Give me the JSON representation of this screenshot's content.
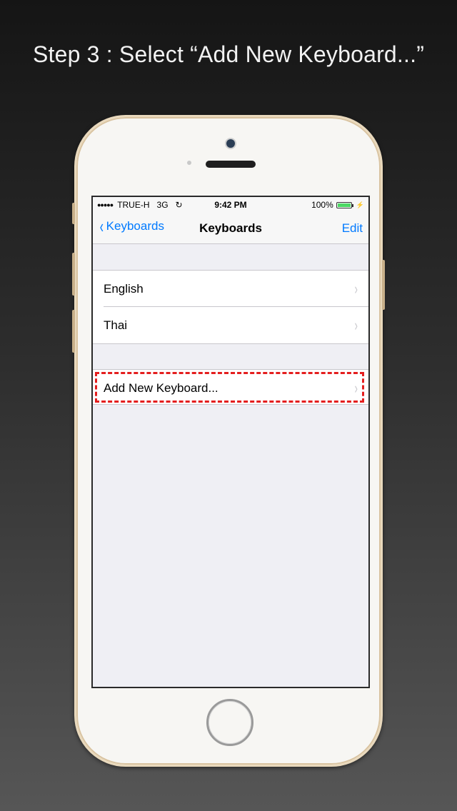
{
  "headline": "Step 3 : Select “Add New Keyboard...”",
  "status": {
    "signal": "●●●●●",
    "carrier": "TRUE-H",
    "network": "3G",
    "sync_icon": "↻",
    "time": "9:42 PM",
    "battery": "100%",
    "charging_icon": "⚡"
  },
  "nav": {
    "back_label": "Keyboards",
    "back_icon": "‹",
    "title": "Keyboards",
    "edit_label": "Edit"
  },
  "keyboards": [
    {
      "label": "English",
      "chevron": "›"
    },
    {
      "label": "Thai",
      "chevron": "›"
    }
  ],
  "add_keyboard": {
    "label": "Add New Keyboard...",
    "chevron": "›"
  },
  "colors": {
    "accent": "#007aff",
    "highlight": "#e41e1e",
    "battery": "#4cd964"
  }
}
